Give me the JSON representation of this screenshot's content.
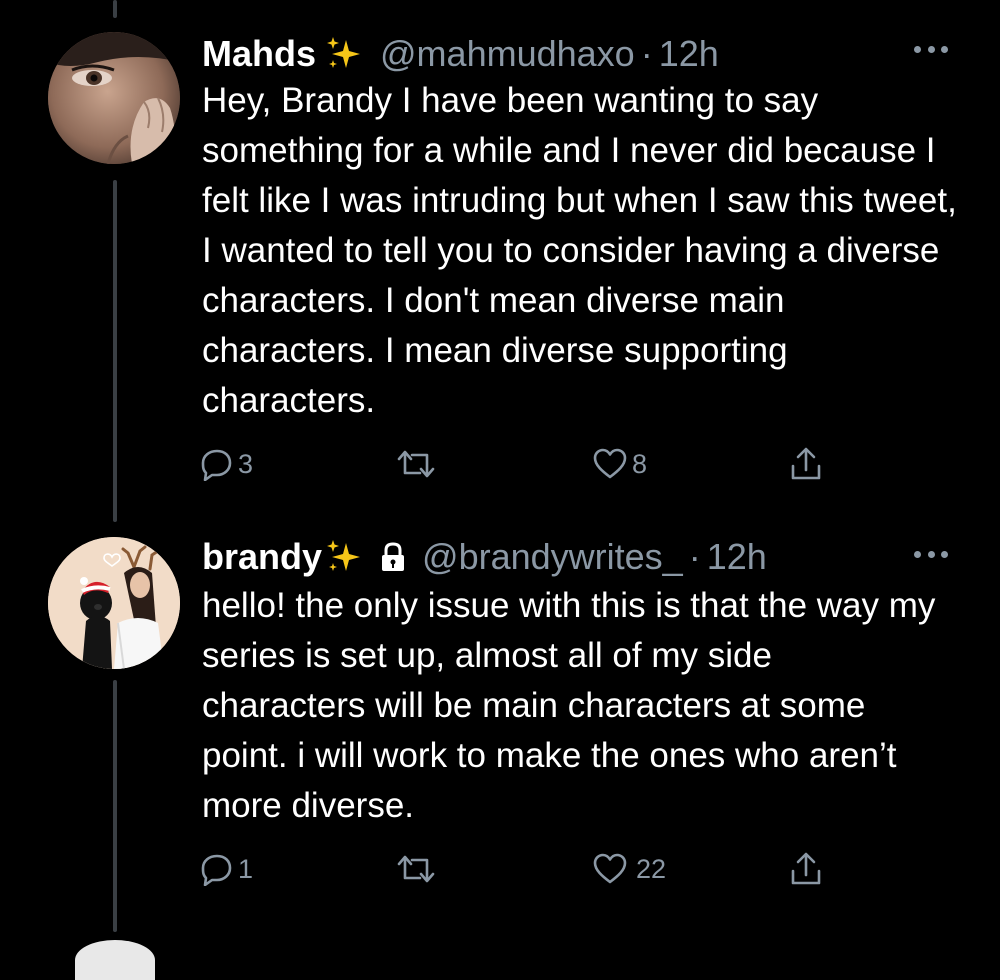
{
  "tweets": [
    {
      "display_name": "Mahds",
      "name_emoji": "sparkles",
      "protected": false,
      "handle": "@mahmudhaxo",
      "separator": "·",
      "time": "12h",
      "text": "Hey, Brandy I have been wanting to say something for a while and I never did because I felt like I was intruding but when I saw this tweet, I wanted to tell you to consider having a diverse characters. I don't mean diverse main characters. I mean diverse supporting characters.",
      "replies": "3",
      "retweets": "",
      "likes": "8"
    },
    {
      "display_name": "brandy",
      "name_emoji": "sparkles",
      "protected": true,
      "handle": "@brandywrites_",
      "separator": "·",
      "time": "12h",
      "text": "hello! the only issue with this is that the way my series is set up, almost all of my side characters will be main characters at some point. i will work to make the ones who aren’t more diverse.",
      "replies": "1",
      "retweets": "",
      "likes": "22"
    }
  ],
  "icons": {
    "reply": "reply-icon",
    "retweet": "retweet-icon",
    "like": "heart-icon",
    "share": "share-icon",
    "more": "more-icon",
    "lock": "lock-icon",
    "sparkles": "sparkles-icon"
  },
  "colors": {
    "background": "#000000",
    "text": "#ffffff",
    "secondary_text": "#8b98a5",
    "thread_line": "#3a3f44",
    "sparkle": "#f5c518"
  }
}
